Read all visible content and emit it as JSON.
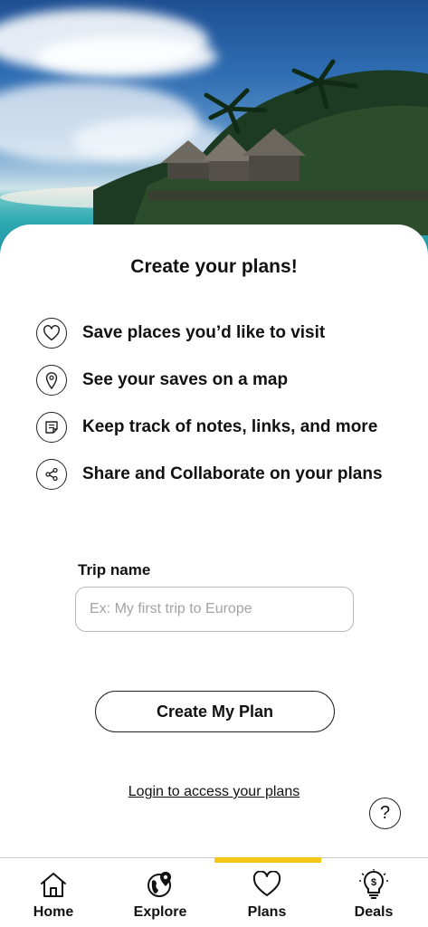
{
  "hero": {
    "image": "tropical-beach-bungalows-photo"
  },
  "title": "Create your plans!",
  "features": [
    {
      "icon": "heart-icon",
      "text": "Save places you’d like to visit"
    },
    {
      "icon": "map-pin-icon",
      "text": "See your saves on a map"
    },
    {
      "icon": "note-icon",
      "text": "Keep track of notes, links, and more"
    },
    {
      "icon": "share-icon",
      "text": "Share and Collaborate on your plans"
    }
  ],
  "trip": {
    "label": "Trip name",
    "placeholder": "Ex: My first trip to Europe",
    "value": ""
  },
  "create_button": "Create My Plan",
  "login_link": "Login to access your plans",
  "help": "?",
  "nav": {
    "active": "Plans",
    "accent_color": "#f5c518",
    "items": [
      {
        "label": "Home",
        "icon": "home-icon"
      },
      {
        "label": "Explore",
        "icon": "globe-pin-icon"
      },
      {
        "label": "Plans",
        "icon": "heart-icon"
      },
      {
        "label": "Deals",
        "icon": "lightbulb-dollar-icon"
      }
    ]
  }
}
